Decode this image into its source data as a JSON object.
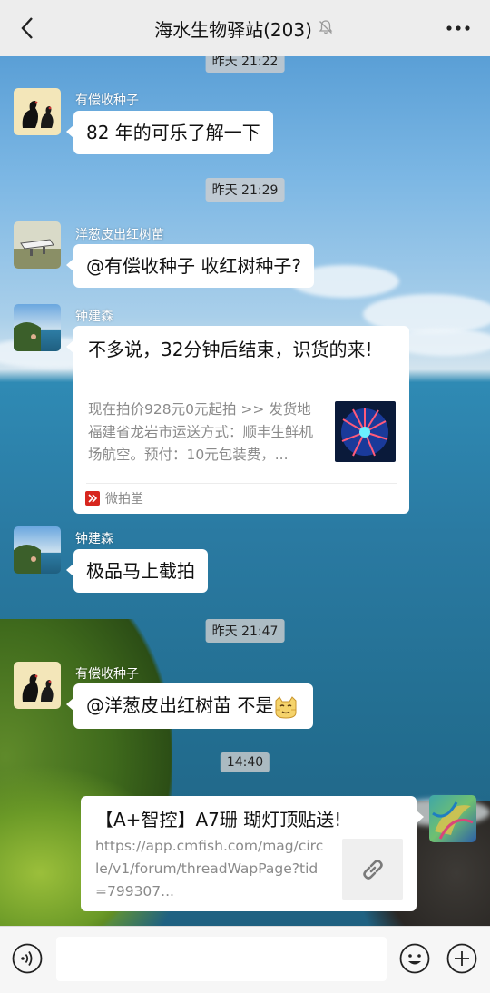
{
  "header": {
    "title": "海水生物驿站(203)",
    "back_icon": "chevron-left-icon",
    "mute_icon": "bell-off-icon",
    "more_icon": "more-dots-icon"
  },
  "messages": {
    "time_0": "昨天 21:22",
    "m1": {
      "sender": "有偿收种子",
      "text": "82 年的可乐了解一下"
    },
    "time_1": "昨天 21:29",
    "m2": {
      "sender": "洋葱皮出红树苗",
      "text": "@有偿收种子  收红树种子?"
    },
    "m3": {
      "sender": "钟建森",
      "card_title": "不多说，32分钟后结束，识货的来!",
      "card_desc": "现在拍价928元0元起拍 >> 发货地福建省龙岩市运送方式：顺丰生鲜机场航空。预付：10元包装费，...",
      "source": "微拍堂"
    },
    "m4": {
      "sender": "钟建森",
      "text": "极品马上截拍"
    },
    "time_2": "昨天 21:47",
    "m5": {
      "sender": "有偿收种子",
      "text": "@洋葱皮出红树苗  不是"
    },
    "time_3": "14:40",
    "m6": {
      "card_title": "【A+智控】A7珊 瑚灯顶贴送!",
      "card_desc": "https://app.cmfish.com/mag/circle/v1/forum/threadWapPage?tid=799307..."
    }
  },
  "input": {
    "placeholder": ""
  },
  "colors": {
    "titlebar": "#ededed",
    "bubble": "#ffffff",
    "inputbar": "#f6f6f6"
  }
}
